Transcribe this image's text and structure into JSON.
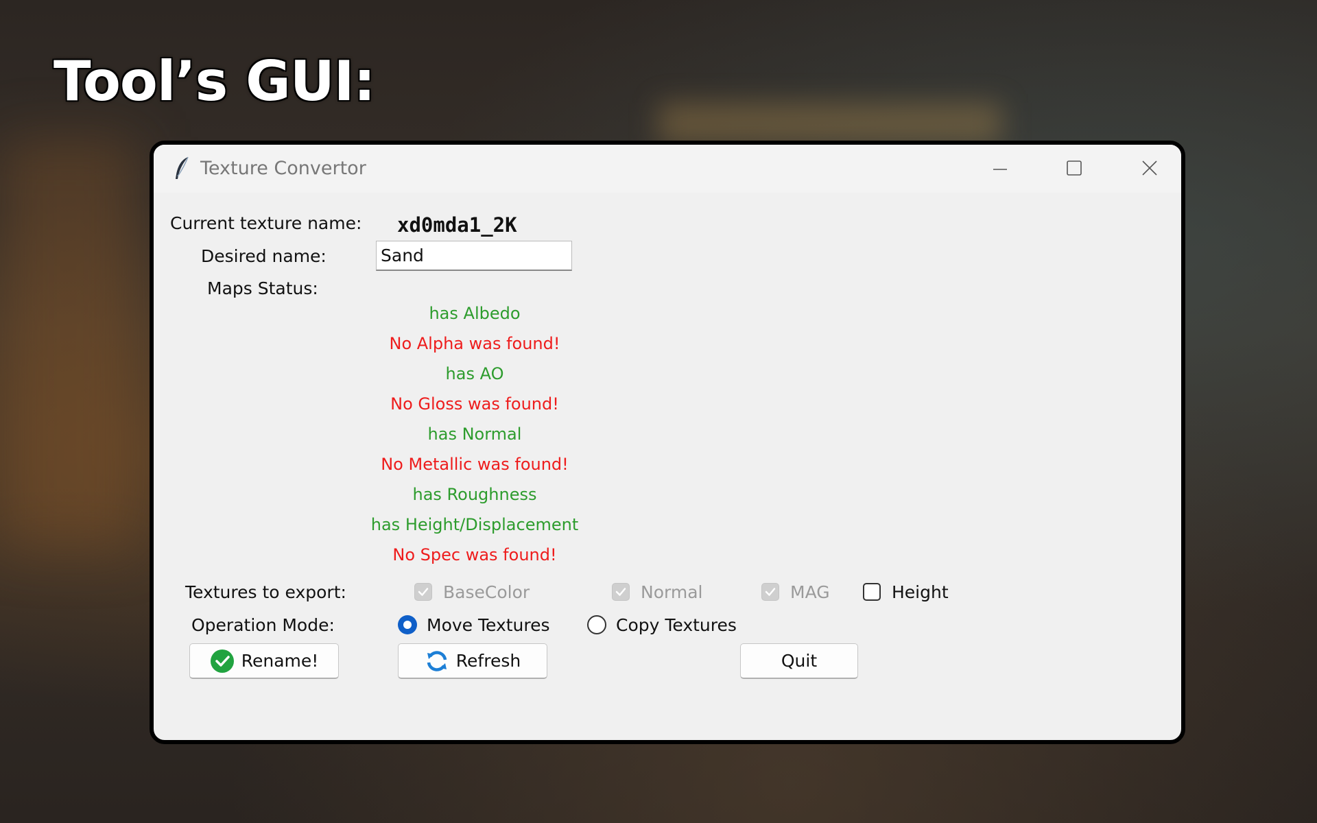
{
  "heading": "Tool’s GUI:",
  "window": {
    "title": "Texture Convertor",
    "icons": {
      "app": "feather-icon",
      "minimize": "minimize-icon",
      "maximize": "maximize-icon",
      "close": "close-icon"
    }
  },
  "form": {
    "current_texture_label": "Current texture name:",
    "current_texture_value": "xd0mda1_2K",
    "desired_name_label": "Desired name:",
    "desired_name_value": "Sand",
    "maps_status_label": "Maps Status:"
  },
  "maps_status": [
    {
      "text": "has Albedo",
      "found": true
    },
    {
      "text": "No Alpha was found!",
      "found": false
    },
    {
      "text": "has AO",
      "found": true
    },
    {
      "text": "No Gloss was found!",
      "found": false
    },
    {
      "text": "has Normal",
      "found": true
    },
    {
      "text": "No Metallic was found!",
      "found": false
    },
    {
      "text": "has Roughness",
      "found": true
    },
    {
      "text": "has Height/Displacement",
      "found": true
    },
    {
      "text": "No Spec was found!",
      "found": false
    }
  ],
  "export": {
    "label": "Textures to export:",
    "options": [
      {
        "label": "BaseColor",
        "checked": true,
        "disabled": true
      },
      {
        "label": "Normal",
        "checked": true,
        "disabled": true
      },
      {
        "label": "MAG",
        "checked": true,
        "disabled": true
      },
      {
        "label": "Height",
        "checked": false,
        "disabled": false
      }
    ]
  },
  "operation": {
    "label": "Operation Mode:",
    "options": [
      {
        "label": "Move Textures",
        "selected": true
      },
      {
        "label": "Copy Textures",
        "selected": false
      }
    ]
  },
  "buttons": {
    "rename": {
      "label": "Rename!",
      "icon": "check-circle-icon"
    },
    "refresh": {
      "label": "Refresh",
      "icon": "refresh-icon"
    },
    "quit": {
      "label": "Quit"
    }
  },
  "colors": {
    "found": "#2d9c2d",
    "missing": "#ee1c1c",
    "radio_accent": "#0f5fc8"
  }
}
